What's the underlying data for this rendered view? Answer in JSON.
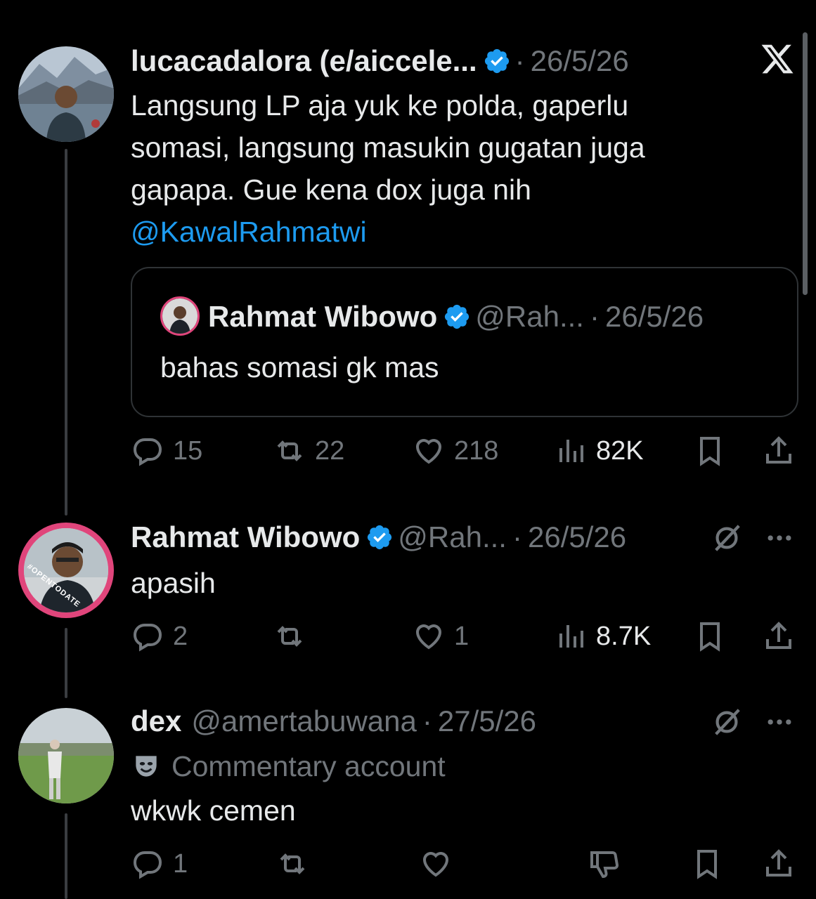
{
  "tweet1": {
    "display_name": "lucacadalora (e/aiccele...",
    "date": "26/5/26",
    "text_lines": [
      "Langsung LP aja yuk ke polda, gaperlu",
      "somasi, langsung masukin gugatan juga",
      "gapapa. Gue kena dox juga nih"
    ],
    "mention": "@KawalRahmatwi",
    "quote": {
      "display_name": "Rahmat Wibowo",
      "handle": "@Rah...",
      "date": "26/5/26",
      "text": "bahas somasi gk mas"
    },
    "actions": {
      "replies": "15",
      "reposts": "22",
      "likes": "218",
      "views": "82K"
    }
  },
  "tweet2": {
    "display_name": "Rahmat Wibowo",
    "handle": "@Rah...",
    "date": "26/5/26",
    "text": "apasih",
    "avatar_badge": "#OPENTODATE",
    "actions": {
      "replies": "2",
      "reposts": "",
      "likes": "1",
      "views": "8.7K"
    }
  },
  "tweet3": {
    "display_name": "dex",
    "handle": "@amertabuwana",
    "date": "27/5/26",
    "label": "Commentary account",
    "text": "wkwk cemen",
    "actions": {
      "replies": "1",
      "reposts": "",
      "likes": ""
    }
  },
  "separator": "·",
  "colors": {
    "background": "#000000",
    "text": "#e7e9ea",
    "muted": "#71767b",
    "accent": "#1d9bf0",
    "verified": "#1d9bf0"
  }
}
